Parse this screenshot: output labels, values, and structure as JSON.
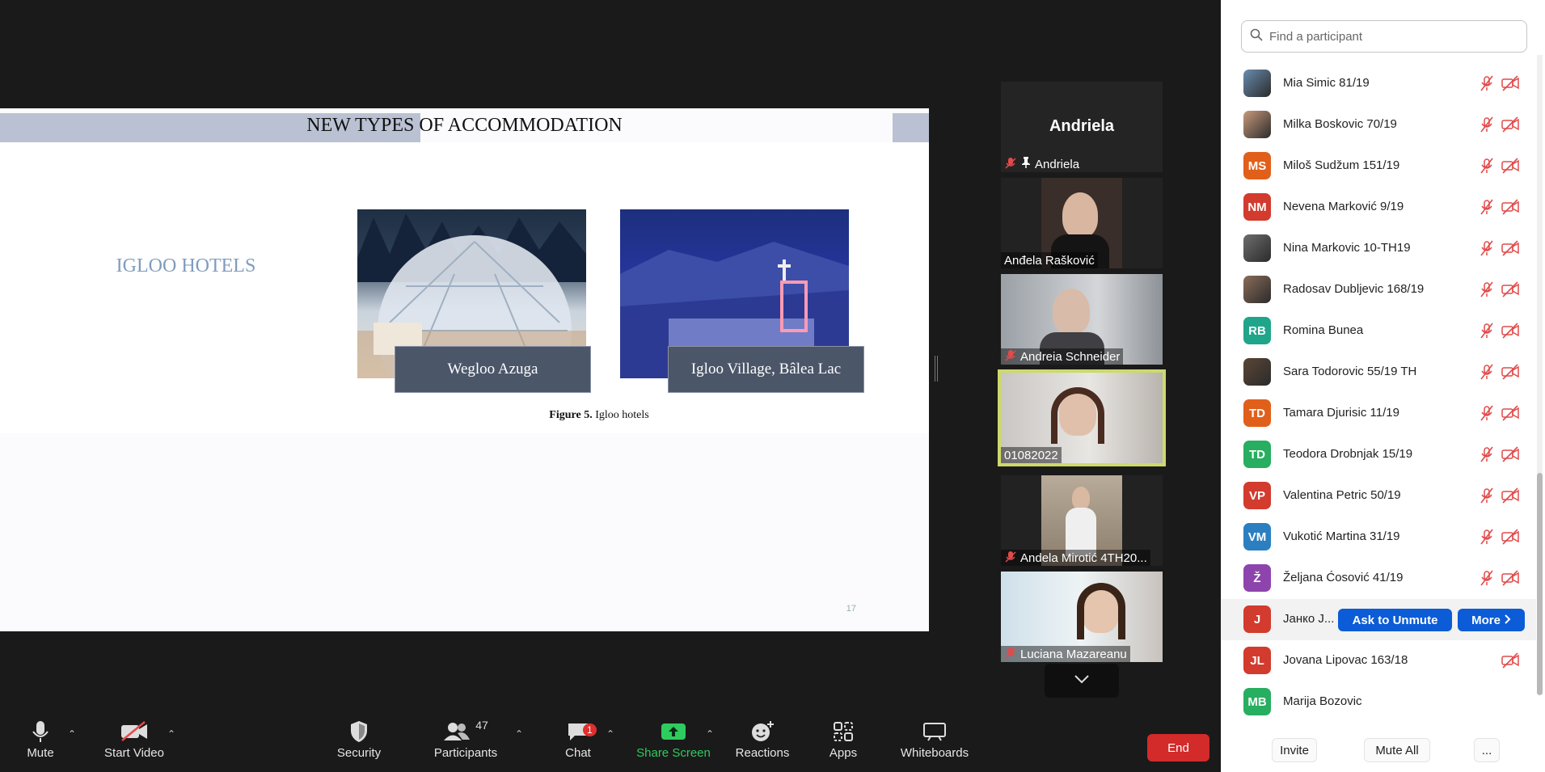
{
  "slide": {
    "title": "NEW TYPES OF ACCOMMODATION",
    "section": "IGLOO HOTELS",
    "caption_left": "Wegloo Azuga",
    "caption_right": "Igloo Village, Bâlea Lac",
    "figure_label": "Figure 5.",
    "figure_text": " Igloo hotels",
    "page_number": "17"
  },
  "video_tiles": [
    {
      "name": "Andriela",
      "big_name": "Andriela",
      "muted": true,
      "pinned": true
    },
    {
      "name": "Anđela Rašković",
      "muted": false
    },
    {
      "name": "Andreia Schneider",
      "muted": true
    },
    {
      "name": "01082022",
      "muted": false,
      "active_speaker": true
    },
    {
      "name": "Andela Mirotić 4TH20...",
      "muted": true
    },
    {
      "name": "Luciana Mazareanu",
      "muted": true
    }
  ],
  "toolbar": {
    "mute": "Mute",
    "start_video": "Start Video",
    "security": "Security",
    "participants": "Participants",
    "participants_count": "47",
    "chat": "Chat",
    "chat_badge": "1",
    "share_screen": "Share Screen",
    "reactions": "Reactions",
    "apps": "Apps",
    "whiteboards": "Whiteboards",
    "end": "End"
  },
  "panel": {
    "search_placeholder": "Find a participant",
    "participants": [
      {
        "name": "Mia Simic 81/19",
        "initials": "",
        "color": "#6a8caf",
        "photo": true
      },
      {
        "name": "Milka Boskovic 70/19",
        "initials": "",
        "color": "#c99a7c",
        "photo": true
      },
      {
        "name": "Miloš Sudžum 151/19",
        "initials": "MS",
        "color": "#e0601b"
      },
      {
        "name": "Nevena Marković 9/19",
        "initials": "NM",
        "color": "#d23b2e"
      },
      {
        "name": "Nina Markovic 10-TH19",
        "initials": "",
        "color": "#6d6d6d",
        "photo": true
      },
      {
        "name": "Radosav Dubljevic 168/19",
        "initials": "",
        "color": "#8a6c58",
        "photo": true
      },
      {
        "name": "Romina Bunea",
        "initials": "RB",
        "color": "#1fa58a"
      },
      {
        "name": "Sara Todorovic 55/19 TH",
        "initials": "",
        "color": "#5a4636",
        "photo": true
      },
      {
        "name": "Tamara Djurisic 11/19",
        "initials": "TD",
        "color": "#e0601b"
      },
      {
        "name": "Teodora Drobnjak 15/19",
        "initials": "TD",
        "color": "#27ae60"
      },
      {
        "name": "Valentina Petric 50/19",
        "initials": "VP",
        "color": "#d23b2e"
      },
      {
        "name": "Vukotić Martina 31/19",
        "initials": "VM",
        "color": "#2b7fc0"
      },
      {
        "name": "Željana Ćosović 41/19",
        "initials": "Ž",
        "color": "#8e44ad"
      },
      {
        "name": "Јанко Ј...",
        "initials": "J",
        "color": "#d23b2e",
        "hover": true
      },
      {
        "name": "Jovana Lipovac 163/18",
        "initials": "JL",
        "color": "#d23b2e"
      },
      {
        "name": "Marija Bozovic",
        "initials": "MB",
        "color": "#27ae60"
      }
    ],
    "ask_to_unmute": "Ask to Unmute",
    "more": "More",
    "invite": "Invite",
    "mute_all": "Mute All",
    "overflow": "..."
  },
  "icons": {
    "search": "search-icon",
    "mic_muted": "mic-muted-icon",
    "cam_muted": "camera-off-icon",
    "pin": "pin-icon",
    "chevron_down": "chevron-down-icon"
  },
  "colors": {
    "accent_blue": "#0b5cd6",
    "end_red": "#d32a2a",
    "share_green": "#2ecc5e",
    "muted_red": "#e24a4a"
  }
}
